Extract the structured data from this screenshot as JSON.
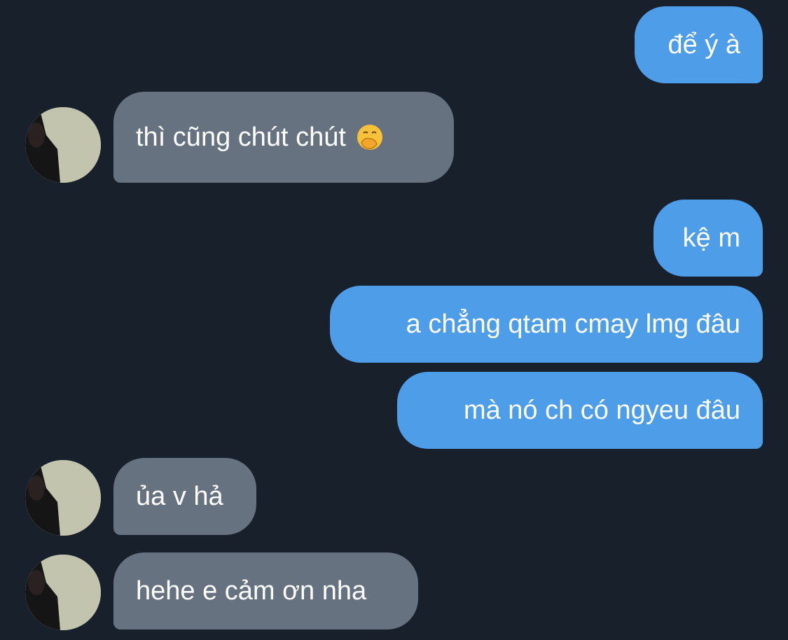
{
  "messages": [
    {
      "id": "m1",
      "direction": "outgoing",
      "text": "để ý à"
    },
    {
      "id": "m2",
      "direction": "incoming",
      "text": "thì cũng chút chút",
      "emoji": "face-with-hand-over-mouth"
    },
    {
      "id": "m3",
      "direction": "outgoing",
      "text": "kệ m"
    },
    {
      "id": "m4",
      "direction": "outgoing",
      "text": "a chẳng qtam cmay lmg đâu"
    },
    {
      "id": "m5",
      "direction": "outgoing",
      "text": "mà nó ch có ngyeu đâu"
    },
    {
      "id": "m6",
      "direction": "incoming",
      "text": "ủa v hả"
    },
    {
      "id": "m7",
      "direction": "incoming",
      "text": "hehe e cảm ơn nha"
    }
  ],
  "colors": {
    "background": "#18202b",
    "outgoing_bubble": "#4d9de8",
    "incoming_bubble": "#66727f",
    "text": "#ffffff"
  }
}
